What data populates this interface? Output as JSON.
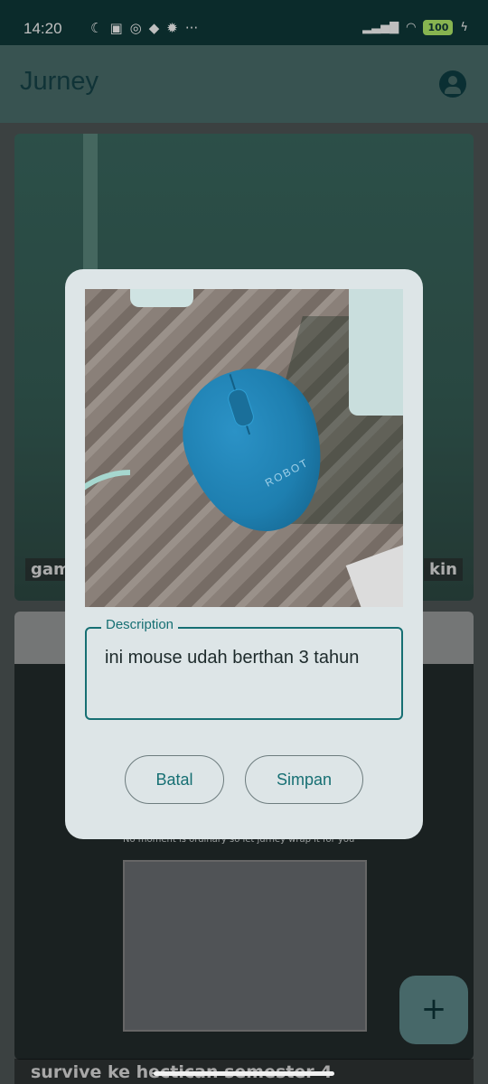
{
  "status": {
    "time": "14:20",
    "battery": "100",
    "more": "···"
  },
  "app": {
    "title": "Jurney"
  },
  "cards": [
    {
      "left_label": "gam",
      "right_label": "kin"
    },
    {
      "tagline": "No moment is ordinary so let jurney wrap it for you",
      "caption": "survive ke hectican semester 4"
    }
  ],
  "dialog": {
    "field_label": "Description",
    "field_value": "ini mouse udah berthan 3 tahun",
    "photo_brand": "ROBOT",
    "cancel_label": "Batal",
    "save_label": "Simpan"
  },
  "fab": {
    "label": "+"
  },
  "colors": {
    "accent": "#166f73",
    "app_bar": "#4b6f6c",
    "dialog_bg": "#dde5e7"
  },
  "icons": [
    "moon-icon",
    "nfc-icon",
    "whatsapp-icon",
    "game-icon",
    "settings-icon",
    "signal-icon",
    "wifi-icon",
    "battery-icon",
    "account-icon",
    "add-icon"
  ]
}
